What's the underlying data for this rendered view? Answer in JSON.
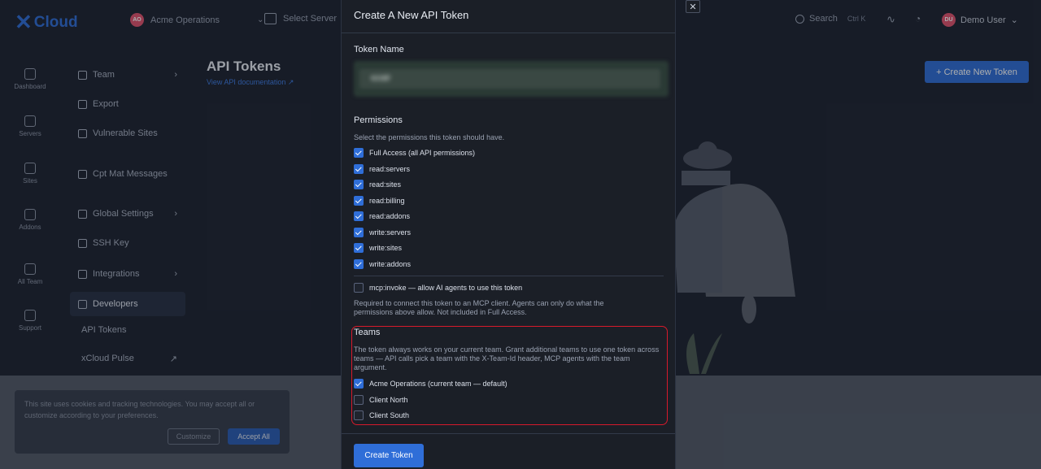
{
  "app": {
    "logo_text": "Cloud",
    "team_name": "Acme Operations",
    "team_initials": "AO",
    "server_select": "Select Server",
    "search_label": "Search",
    "search_kbd": "Ctrl K",
    "user_name": "Demo User",
    "user_initials": "DU"
  },
  "rail": [
    "Dashboard",
    "Servers",
    "Sites",
    "Addons",
    "All Team",
    "Support"
  ],
  "sidenav": {
    "items": [
      "Team",
      "Export",
      "Vulnerable Sites",
      "Cpt Mat Messages",
      "Global Settings",
      "SSH Key",
      "Integrations",
      "Developers",
      "API Tokens",
      "xCloud Pulse"
    ]
  },
  "page": {
    "title": "API Tokens",
    "doc_link": "View API documentation ↗",
    "create_button": "+ Create New Token"
  },
  "cookie": {
    "text": "This site uses cookies and tracking technologies. You may accept all or customize according to your preferences.",
    "customize": "Customize",
    "accept": "Accept All"
  },
  "modal": {
    "title": "Create A New API Token",
    "close": "✕",
    "token_name_label": "Token Name",
    "token_name_value": "ezatr",
    "permissions_label": "Permissions",
    "permissions_hint": "Select the permissions this token should have.",
    "permissions": [
      {
        "label": "Full Access (all API permissions)",
        "checked": true
      },
      {
        "label": "read:servers",
        "checked": true
      },
      {
        "label": "read:sites",
        "checked": true
      },
      {
        "label": "read:billing",
        "checked": true
      },
      {
        "label": "read:addons",
        "checked": true
      },
      {
        "label": "write:servers",
        "checked": true
      },
      {
        "label": "write:sites",
        "checked": true
      },
      {
        "label": "write:addons",
        "checked": true
      }
    ],
    "mcp": {
      "label": "mcp:invoke — allow AI agents to use this token",
      "checked": false
    },
    "mcp_hint": "Required to connect this token to an MCP client. Agents can only do what the permissions above allow. Not included in Full Access.",
    "teams_label": "Teams",
    "teams_hint": "The token always works on your current team. Grant additional teams to use one token across teams — API calls pick a team with the X-Team-Id header, MCP agents with the team argument.",
    "teams": [
      {
        "label": "Acme Operations (current team — default)",
        "checked": true
      },
      {
        "label": "Client North",
        "checked": false
      },
      {
        "label": "Client South",
        "checked": false
      }
    ],
    "submit": "Create Token"
  }
}
